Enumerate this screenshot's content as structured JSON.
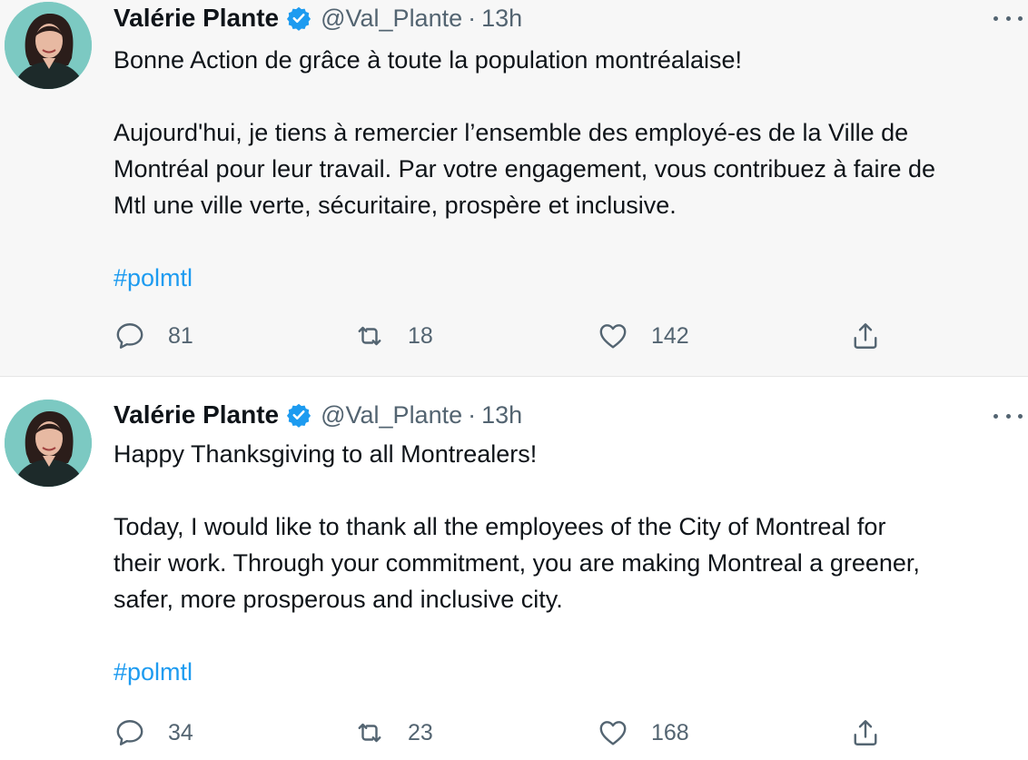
{
  "tweets": [
    {
      "author": {
        "name": "Valérie Plante",
        "handle": "@Val_Plante",
        "separator": "·",
        "time": "13h",
        "verified": true
      },
      "lines": [
        "Bonne Action de grâce à toute la population montréalaise!",
        "",
        "Aujourd'hui, je tiens à remercier l’ensemble des employé-es de la Ville de",
        "Montréal pour leur travail. Par votre engagement, vous contribuez à faire de",
        "Mtl une ville verte, sécuritaire, prospère et inclusive.",
        ""
      ],
      "hashtag": "#polmtl",
      "stats": {
        "replies": "81",
        "retweets": "18",
        "likes": "142"
      }
    },
    {
      "author": {
        "name": "Valérie Plante",
        "handle": "@Val_Plante",
        "separator": "·",
        "time": "13h",
        "verified": true
      },
      "lines": [
        "Happy Thanksgiving to all Montrealers!",
        "",
        "Today, I would like to thank all the employees of the City of Montreal for",
        "their work. Through your commitment, you are making Montreal a greener,",
        "safer, more prosperous and inclusive city.",
        ""
      ],
      "hashtag": "#polmtl",
      "stats": {
        "replies": "34",
        "retweets": "23",
        "likes": "168"
      }
    }
  ],
  "icons": {
    "verified": "verified-badge-icon",
    "more": "more-options-icon",
    "reply": "reply-icon",
    "retweet": "retweet-icon",
    "like": "like-icon",
    "share": "share-icon"
  },
  "colors": {
    "link": "#1d9bf0",
    "muted": "#536471",
    "text": "#0f1419",
    "highlight_bg": "#f7f7f7"
  }
}
